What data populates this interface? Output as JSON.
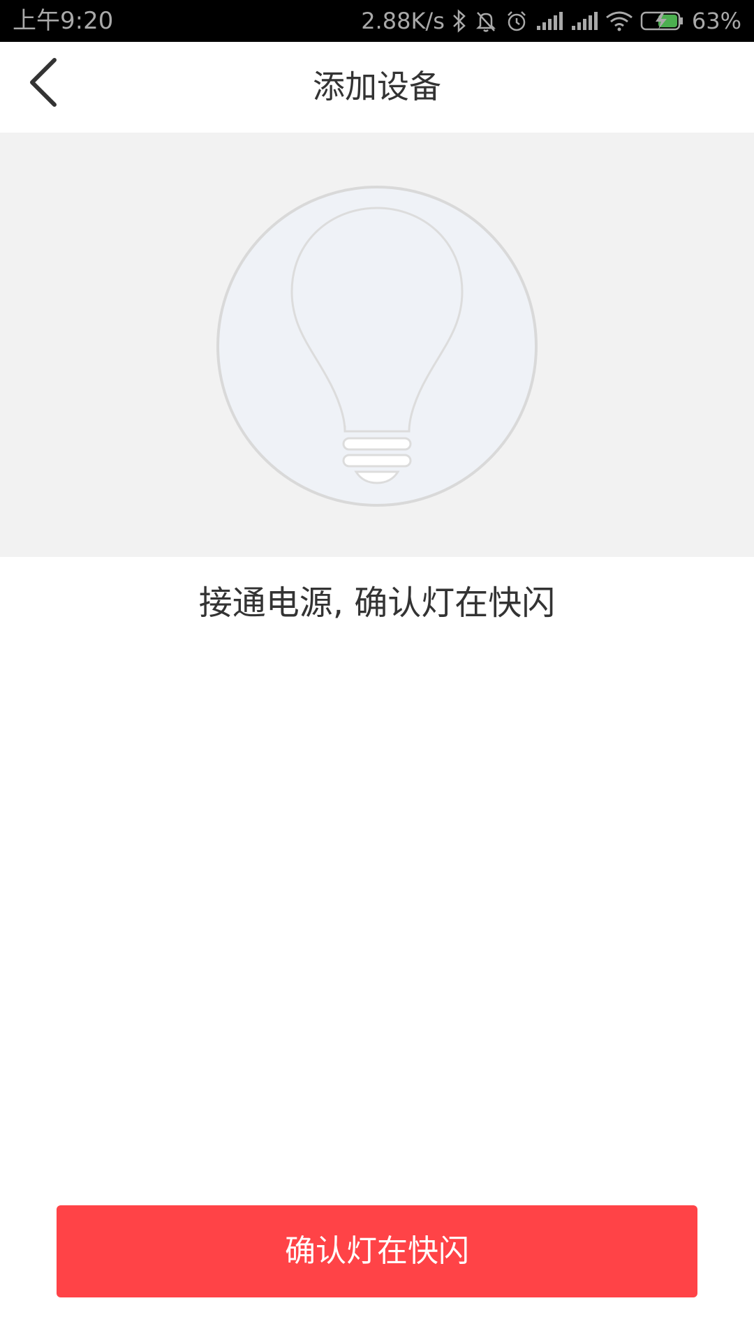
{
  "status_bar": {
    "time": "上午9:20",
    "net_speed": "2.88K/s",
    "battery": "63%"
  },
  "header": {
    "title": "添加设备"
  },
  "hero": {
    "icon": "lightbulb-icon"
  },
  "instruction": "接通电源, 确认灯在快闪",
  "confirm_button": {
    "label": "确认灯在快闪"
  },
  "colors": {
    "accent": "#ff4347",
    "panel_bg": "#f2f2f2",
    "text_primary": "#333333"
  }
}
